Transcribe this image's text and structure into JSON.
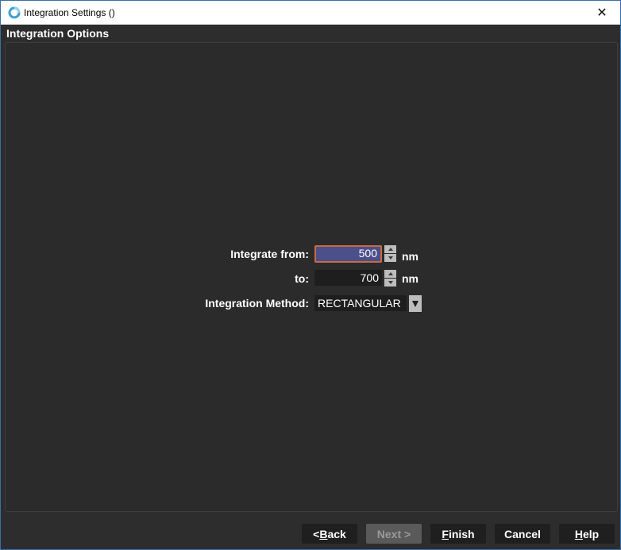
{
  "window": {
    "title": "Integration Settings ()",
    "close_glyph": "✕"
  },
  "section": {
    "title": "Integration Options"
  },
  "form": {
    "from_label": "Integrate from:",
    "from_value": "500",
    "to_label": "to:",
    "to_value": "700",
    "unit": "nm",
    "method_label": "Integration Method:",
    "method_value": "RECTANGULAR"
  },
  "buttons": {
    "back_mnemonic": "< ",
    "back_underlined": "B",
    "back_rest": "ack",
    "next": "Next >",
    "finish_underlined": "F",
    "finish_rest": "inish",
    "cancel": "Cancel",
    "help_underlined": "H",
    "help_rest": "elp"
  },
  "colors": {
    "background": "#2d2d2d",
    "focused_field": "#4b4f8a",
    "focus_border": "#c96a44",
    "field_bg": "#1e1e1e"
  }
}
